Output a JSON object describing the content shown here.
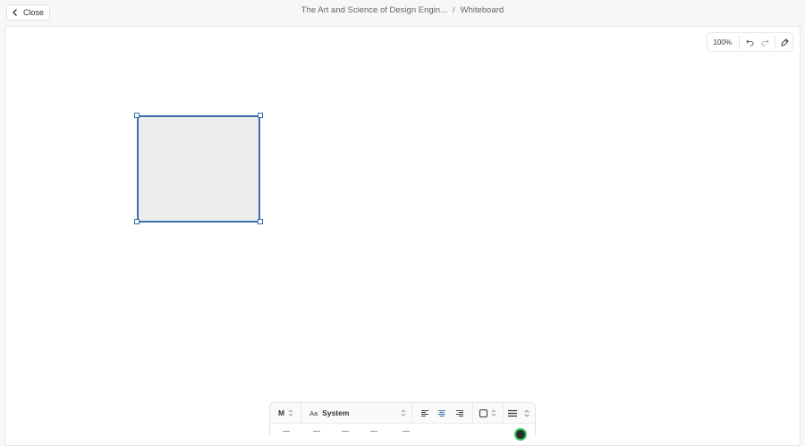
{
  "header": {
    "close_label": "Close",
    "breadcrumb_document": "The Art and Science of Design Engin...",
    "breadcrumb_separator": "/",
    "breadcrumb_page": "Whiteboard"
  },
  "top_tools": {
    "zoom": "100%",
    "undo_icon": "undo-icon",
    "redo_icon": "redo-icon",
    "pen_icon": "pen-icon"
  },
  "style_bar": {
    "size": "M",
    "font_prefix": "Aa",
    "font": "System",
    "align_options": [
      "align-left-icon",
      "align-center-icon",
      "align-right-icon"
    ],
    "align_selected": "center",
    "fill_icon": "fill-square-icon",
    "stroke_icon": "stroke-width-icon"
  },
  "colors": {
    "accent": "#3a6fb0",
    "shape_fill": "#ececec",
    "active_color_ring": "#3bc35a",
    "active_color": "#2d2d2d"
  }
}
